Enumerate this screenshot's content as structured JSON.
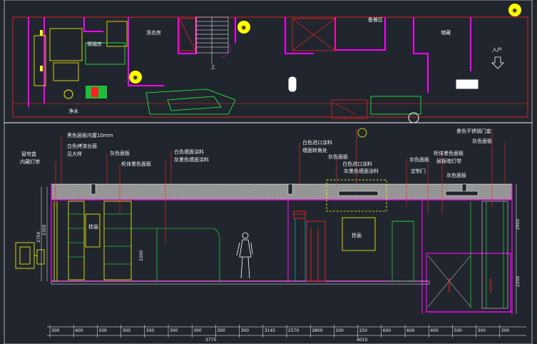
{
  "plan": {
    "rooms": {
      "laundry": "洗衣房",
      "nanny_room": "保姆房",
      "water_purifier": "净水",
      "kitchen_top": "备餐区",
      "storage": "储藏",
      "entry": "入户",
      "up": "上"
    }
  },
  "elevation": {
    "callouts": {
      "c1": "黑色层板内置10mm",
      "c2": "白色烤漆台面",
      "c3": "见大样",
      "c4": "窗帘盒",
      "c5": "内藏灯带",
      "c6": "灰色面板",
      "c7": "柜体墨色面板",
      "c8": "白色墙面涂料",
      "c9": "灰墨色墙面涂料",
      "c10": "白色进口涂料",
      "c11": "墙面转角处",
      "c12": "灰色面板",
      "c13": "白色进口涂料",
      "c14": "灰墨色墙面涂料",
      "c15": "灰色面板",
      "c16": "定制门",
      "c17": "柜体墨色面板",
      "c18": "层板暗灯带",
      "c19": "灰色面板",
      "c20": "墨色不锈钢门套",
      "c21": "灰色面板"
    },
    "panel_labels": {
      "p1": "挂画",
      "p2": "挂画"
    },
    "dimensions_top": [
      "300",
      "600",
      "500",
      "300",
      "300",
      "300",
      "300",
      "300",
      "300",
      "3145",
      "2570",
      "2800",
      "200",
      "250",
      "600",
      "600",
      "400",
      "500",
      "300",
      "300"
    ],
    "dimensions_bottom": [
      "3775",
      "4010"
    ],
    "heights": {
      "h_left_1": "2700",
      "h_left_2": "2350",
      "h_mid": "2200",
      "h_right_1": "2950",
      "h_right_2": "2250"
    }
  },
  "colors": {
    "background": "#21262e",
    "wall": "#ff00ff",
    "red_line": "#ff2020",
    "green_line": "#20ff40",
    "yellow": "#ffff00",
    "cyan": "#00e5ff",
    "hatch": "#9a9a9a"
  }
}
